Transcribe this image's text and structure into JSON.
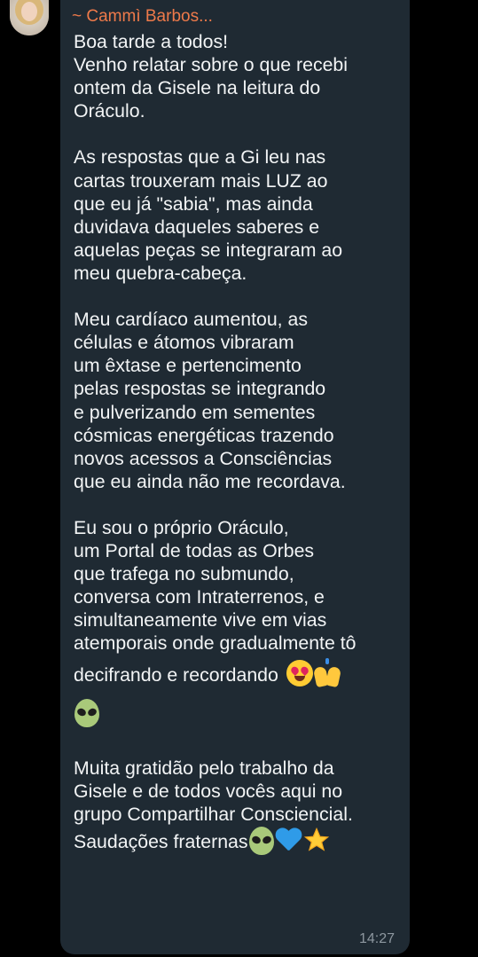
{
  "message": {
    "sender": "~ Cammì Barbos...",
    "time": "14:27",
    "paragraphs": [
      [
        "Boa tarde a todos!",
        "Venho relatar sobre o que recebi",
        "ontem da Gisele na leitura do",
        "Oráculo."
      ],
      [
        "As respostas que a Gi leu nas",
        "cartas trouxeram mais LUZ ao",
        "que eu já \"sabia\", mas ainda",
        "duvidava daqueles saberes e",
        "aquelas peças se integraram ao",
        "meu quebra-cabeça."
      ],
      [
        "Meu cardíaco aumentou, as",
        "células e átomos vibraram",
        "um êxtase e pertencimento",
        "pelas respostas se integrando",
        "e pulverizando em sementes",
        "cósmicas energéticas trazendo",
        "novos acessos a Consciências",
        "que eu ainda não me recordava."
      ],
      [
        "Eu sou o próprio Oráculo,",
        "um Portal de todas as Orbes",
        "que trafega no submundo,",
        "conversa com Intraterrenos, e",
        "simultaneamente vive em vias",
        "atemporais onde gradualmente tô",
        "decifrando e recordando"
      ],
      [
        "Muita gratidão pelo trabalho da",
        "Gisele e de todos vocês aqui no",
        "grupo Compartilhar Consciencial.",
        "Saudações fraternas"
      ]
    ],
    "emojis": {
      "line_decifrando": [
        "smiling-face-with-heart-eyes",
        "raising-hands"
      ],
      "line_alien": [
        "alien"
      ],
      "line_saudacoes": [
        "alien",
        "blue-heart",
        "star"
      ]
    }
  },
  "colors": {
    "background": "#000000",
    "bubble": "#1f2a33",
    "sender": "#ee7a4a",
    "text": "#f2f4f5",
    "time": "#8d979f"
  }
}
